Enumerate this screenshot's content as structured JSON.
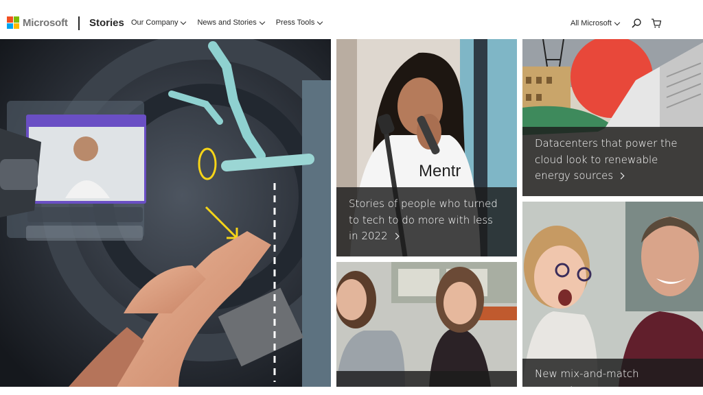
{
  "header": {
    "logo_text": "Microsoft",
    "logo_colors": [
      "#f25022",
      "#7fba00",
      "#00a4ef",
      "#ffb900"
    ],
    "brand": "Stories",
    "nav": [
      {
        "label": "Our Company"
      },
      {
        "label": "News and Stories"
      },
      {
        "label": "Press Tools"
      }
    ],
    "all_microsoft": "All Microsoft",
    "icons": {
      "search": "search-icon",
      "cart": "shopping-cart-icon"
    }
  },
  "tiles": {
    "hero": {
      "image": "engineer-mixed-reality-engine-photo"
    },
    "tech_story": {
      "caption": "Stories of people who turned to tech to do more with less in 2022",
      "image": "woman-speaking-microphone-photo"
    },
    "datacenter": {
      "caption": "Datacenters that power the cloud look to renewable energy sources",
      "image": "datacenter-collage-illustration"
    },
    "women": {
      "image": "two-women-smiling-photo"
    },
    "computer": {
      "caption": "New mix-and-match computer",
      "image": "child-and-man-laughing-photo"
    }
  }
}
